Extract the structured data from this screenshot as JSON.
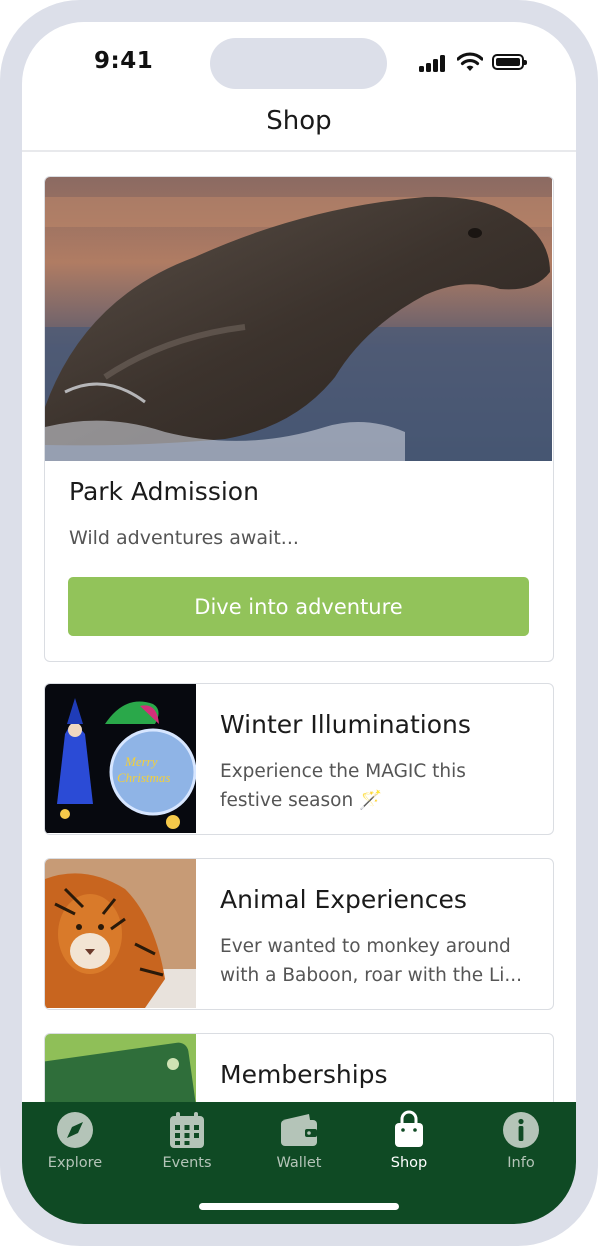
{
  "status_bar": {
    "time": "9:41"
  },
  "header": {
    "title": "Shop"
  },
  "hero_card": {
    "title": "Park Admission",
    "subtitle": "Wild adventures await...",
    "button_label": "Dive into adventure"
  },
  "cards": [
    {
      "title": "Winter Illuminations",
      "line1": "Experience the MAGIC this",
      "line2": "festive season 🪄",
      "image_icon": "lantern-santa-photo"
    },
    {
      "title": "Animal Experiences",
      "line1": "Ever wanted to monkey around",
      "line2": "with a Baboon, roar with the Li...",
      "image_icon": "tiger-photo"
    },
    {
      "title": "Memberships",
      "line1": "",
      "line2": "",
      "image_icon": "membership-card-photo"
    }
  ],
  "tabs": [
    {
      "label": "Explore",
      "icon": "compass-icon"
    },
    {
      "label": "Events",
      "icon": "calendar-icon"
    },
    {
      "label": "Wallet",
      "icon": "wallet-icon"
    },
    {
      "label": "Shop",
      "icon": "shopping-bag-icon",
      "active": true
    },
    {
      "label": "Info",
      "icon": "info-icon"
    }
  ],
  "colors": {
    "accent_button": "#92c35a",
    "tab_bar": "#0f4a24"
  }
}
